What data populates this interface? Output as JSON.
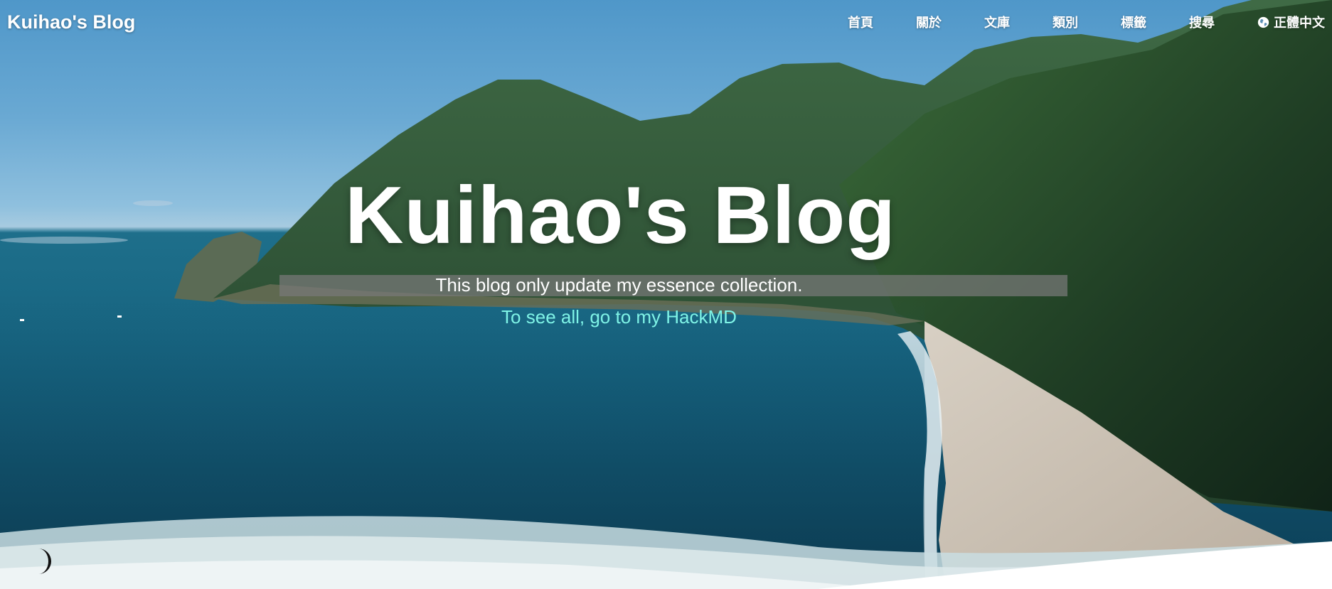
{
  "header": {
    "logo": "Kuihao's Blog",
    "nav": [
      {
        "label": "首頁"
      },
      {
        "label": "關於"
      },
      {
        "label": "文庫"
      },
      {
        "label": "類別"
      },
      {
        "label": "標籤"
      },
      {
        "label": "搜尋"
      }
    ],
    "language": {
      "label": "正體中文",
      "icon": "globe-icon"
    }
  },
  "hero": {
    "title": "Kuihao's Blog",
    "subtitle": "This blog only update my essence collection.",
    "link_text": "To see all, go to my HackMD",
    "link_color": "#7ff3e6"
  },
  "theme_toggle": {
    "icon": "moon-icon"
  }
}
